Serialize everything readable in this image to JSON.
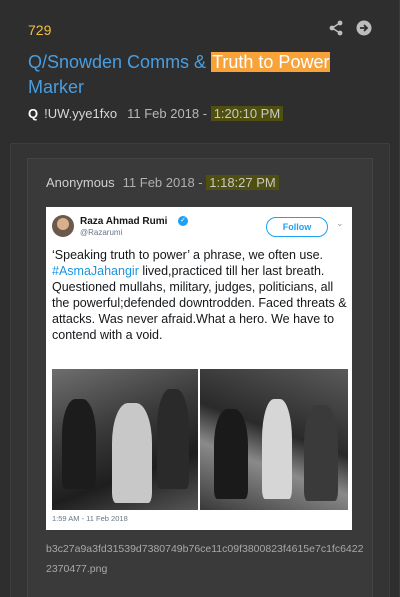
{
  "post": {
    "number": "729",
    "title_prefix": "Q/Snowden Comms & ",
    "title_highlight": "Truth to Power",
    "title_suffix": "Marker",
    "q_label": "Q",
    "tripcode": "!UW.yye1fxo",
    "date": "11 Feb 2018 - ",
    "time": "1:20:10 PM"
  },
  "reply": {
    "name": "Anonymous",
    "date": "11 Feb 2018 - ",
    "time": "1:18:27 PM",
    "tweet": {
      "author": "Raza Ahmad Rumi",
      "handle": "@Razarumi",
      "follow_label": "Follow",
      "text_before": "‘Speaking truth to power’ a phrase, we often use. ",
      "hashtag": "#AsmaJahangir",
      "text_after": " lived,practiced till her last breath. Questioned mullahs, military, judges, politicians, all the powerful;defended downtrodden. Faced threats & attacks. Was never afraid.What a hero. We have to contend with a void.",
      "timestamp": "1:59 AM - 11 Feb 2018"
    },
    "filename": "b3c27a9a3fd31539d7380749b76ce11c09f3800823f4615e7c1fc64222370477.png"
  },
  "colors": {
    "post_number": "#f0c040",
    "title_link": "#4a9ee0",
    "title_highlight": "#f7a33a",
    "time_highlight": "#4f4f10",
    "twitter_blue": "#1da1f2"
  },
  "icons": [
    "share-icon",
    "arrow-right-circle-icon",
    "verified-icon",
    "chevron-down-icon"
  ]
}
